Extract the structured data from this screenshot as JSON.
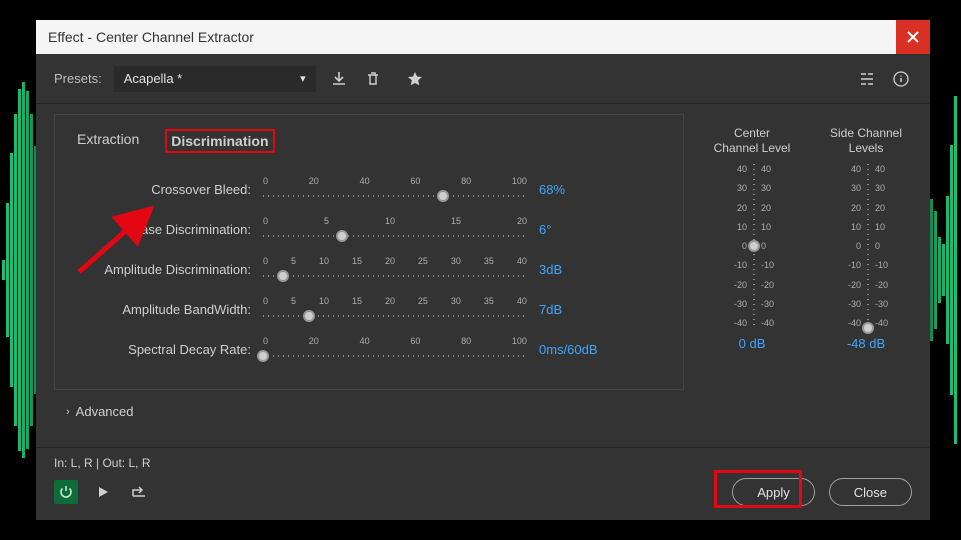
{
  "window_title": "Effect - Center Channel Extractor",
  "presets_label": "Presets:",
  "preset_selected": "Acapella *",
  "tabs": {
    "extraction": "Extraction",
    "discrimination": "Discrimination"
  },
  "sliders": {
    "crossover_bleed": {
      "label": "Crossover Bleed:",
      "ticks": [
        "0",
        "20",
        "40",
        "60",
        "80",
        "100"
      ],
      "value": "68",
      "unit": "%",
      "pos": 68
    },
    "phase_discrimination": {
      "label": "Phase Discrimination:",
      "ticks": [
        "0",
        "5",
        "10",
        "15",
        "20"
      ],
      "value": "6",
      "unit": "°",
      "pos": 30
    },
    "amplitude_discrimination": {
      "label": "Amplitude Discrimination:",
      "ticks": [
        "0",
        "5",
        "10",
        "15",
        "20",
        "25",
        "30",
        "35",
        "40"
      ],
      "value": "3",
      "unit": "dB",
      "pos": 7.5
    },
    "amplitude_bandwidth": {
      "label": "Amplitude BandWidth:",
      "ticks": [
        "0",
        "5",
        "10",
        "15",
        "20",
        "25",
        "30",
        "35",
        "40"
      ],
      "value": "7",
      "unit": "dB",
      "pos": 17.5
    },
    "spectral_decay_rate": {
      "label": "Spectral Decay Rate:",
      "ticks": [
        "0",
        "20",
        "40",
        "60",
        "80",
        "100"
      ],
      "value": "0",
      "unit": "ms/60dB",
      "pos": 0
    }
  },
  "levels": {
    "center": {
      "title1": "Center",
      "title2": "Channel Level",
      "ticks": [
        "40",
        "30",
        "20",
        "10",
        "0",
        "-10",
        "-20",
        "-30",
        "-40"
      ],
      "value": "0",
      "unit": "dB",
      "pos": 50
    },
    "side": {
      "title1": "Side Channel",
      "title2": "Levels",
      "ticks": [
        "40",
        "30",
        "20",
        "10",
        "0",
        "-10",
        "-20",
        "-30",
        "-40"
      ],
      "value": "-48",
      "unit": "dB",
      "pos": 100
    }
  },
  "advanced_label": "Advanced",
  "io_text": "In: L, R | Out: L, R",
  "apply_label": "Apply",
  "close_label": "Close"
}
